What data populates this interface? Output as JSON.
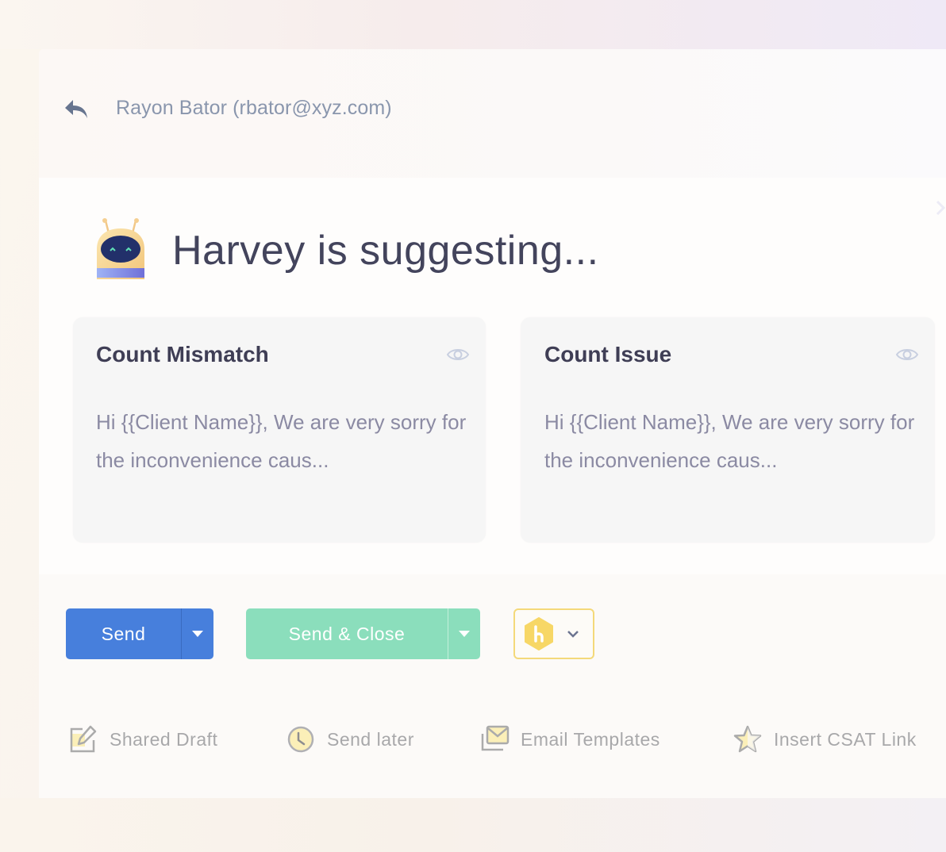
{
  "header": {
    "recipient": "Rayon Bator (rbator@xyz.com)",
    "reply_icon": "reply-arrow-icon"
  },
  "suggestions": {
    "title": "Harvey is suggesting...",
    "bot_icon": "robot-avatar-icon",
    "cards": [
      {
        "title": "Count Mismatch",
        "body": "Hi {{Client Name}},  We are very sorry for the inconvenience caus...",
        "icon": "eye-icon"
      },
      {
        "title": "Count Issue",
        "body": "Hi {{Client Name}},  We are very sorry for the inconvenience caus...",
        "icon": "eye-icon"
      }
    ]
  },
  "actions": {
    "send_label": "Send",
    "send_close_label": "Send & Close",
    "app_selector_icon": "hexagon-app-icon"
  },
  "tools": [
    {
      "label": "Shared Draft",
      "icon": "edit-icon"
    },
    {
      "label": "Send later",
      "icon": "clock-icon"
    },
    {
      "label": "Email Templates",
      "icon": "email-templates-icon"
    },
    {
      "label": "Insert CSAT Link",
      "icon": "star-icon"
    }
  ],
  "colors": {
    "send": "#477fdc",
    "send_close": "#8bdebc",
    "app_accent": "#f7d766",
    "title_text": "#43445c",
    "muted_text": "#8b8aa3"
  }
}
